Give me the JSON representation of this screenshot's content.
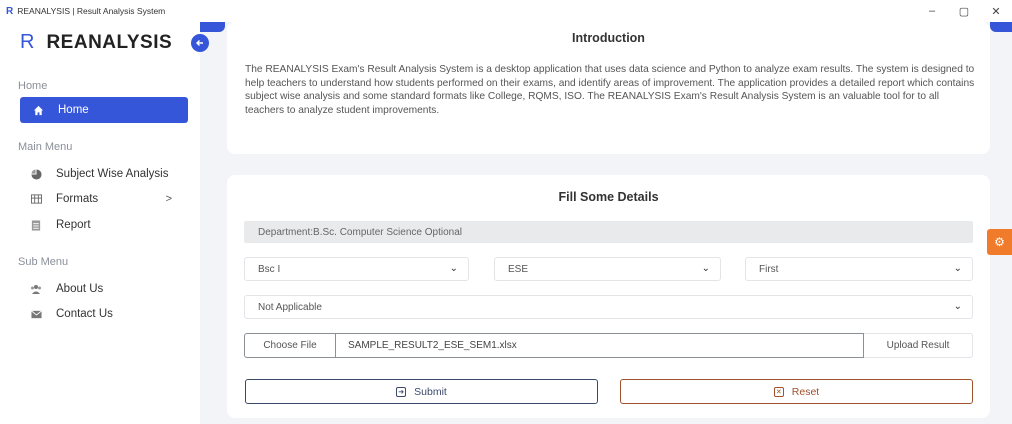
{
  "window": {
    "title": "REANALYSIS | Result Analysis System",
    "app_icon": "R",
    "minimize": "–",
    "maximize": "▢",
    "close": "✕"
  },
  "colors": {
    "accent": "#3556d8",
    "reset": "#a0522d",
    "settings_tab": "#f07b2b"
  },
  "sidebar": {
    "brand_icon": "R",
    "brand_name": "REANALYSIS",
    "sections": {
      "home": "Home",
      "main_menu": "Main Menu",
      "sub_menu": "Sub Menu"
    },
    "items": [
      {
        "label": "Home",
        "icon": "home-icon"
      },
      {
        "label": "Subject Wise Analysis",
        "icon": "pie-chart-icon"
      },
      {
        "label": "Formats",
        "icon": "table-icon",
        "chevron": ">"
      },
      {
        "label": "Report",
        "icon": "document-icon"
      },
      {
        "label": "About Us",
        "icon": "users-icon"
      },
      {
        "label": "Contact Us",
        "icon": "envelope-icon"
      }
    ]
  },
  "intro": {
    "title": "Introduction",
    "text": "The REANALYSIS Exam's Result Analysis System is a desktop application that uses data science and Python to analyze exam results. The system is designed to help teachers to understand how students performed on their exams, and identify areas of improvement. The application provides a detailed report which contains subject wise analysis and some standard formats like College, RQMS, ISO. The REANALYSIS Exam's Result Analysis System is an valuable tool for to all teachers to analyze student improvements."
  },
  "form": {
    "title": "Fill Some Details",
    "department": "Department:B.Sc. Computer Science Optional",
    "class_select": "Bsc I",
    "exam_select": "ESE",
    "semester_select": "First",
    "optional_select": "Not Applicable",
    "choose_file": "Choose File",
    "file_name": "SAMPLE_RESULT2_ESE_SEM1.xlsx",
    "upload": "Upload Result",
    "submit": "Submit",
    "reset": "Reset"
  }
}
